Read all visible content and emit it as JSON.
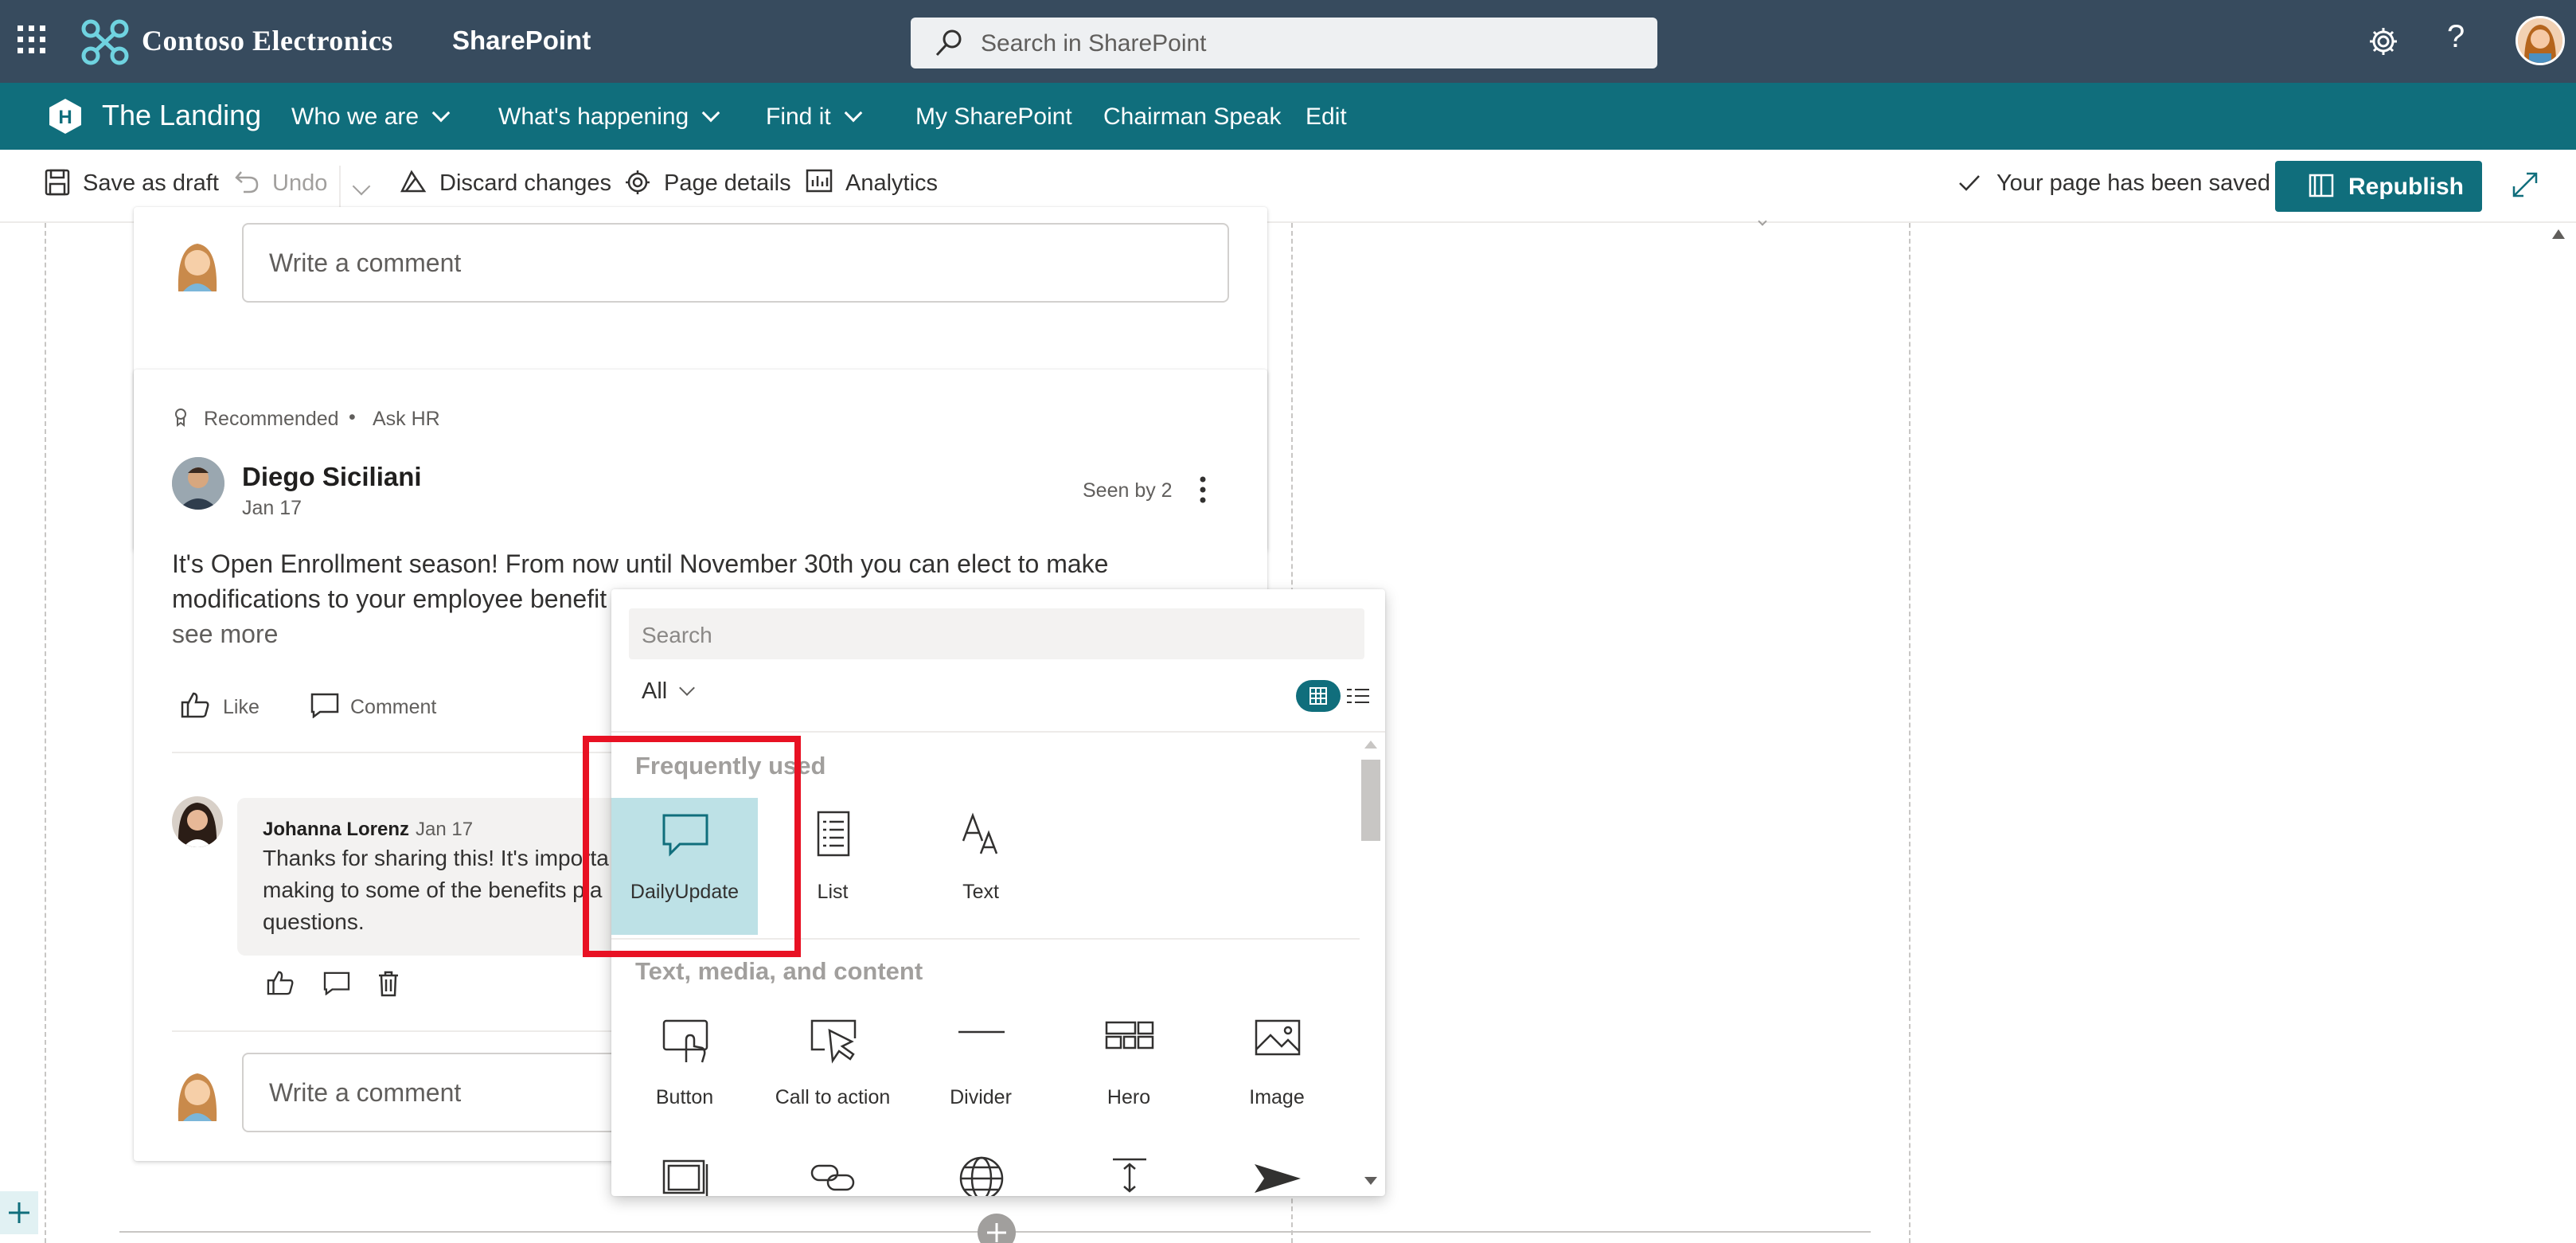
{
  "suite": {
    "org_name": "Contoso Electronics",
    "app_name": "SharePoint",
    "search_placeholder": "Search in SharePoint",
    "help_glyph": "?"
  },
  "hub": {
    "site_name": "The Landing",
    "nav": [
      {
        "label": "Who we are",
        "has_menu": true
      },
      {
        "label": "What's happening",
        "has_menu": true
      },
      {
        "label": "Find it",
        "has_menu": true
      },
      {
        "label": "My SharePoint",
        "has_menu": false
      },
      {
        "label": "Chairman Speak",
        "has_menu": false
      },
      {
        "label": "Edit",
        "has_menu": false
      }
    ]
  },
  "commandbar": {
    "save_draft": "Save as draft",
    "undo": "Undo",
    "discard": "Discard changes",
    "page_details": "Page details",
    "analytics": "Analytics",
    "saved_status": "Your page has been saved",
    "republish": "Republish"
  },
  "feed": {
    "comment_placeholder": "Write a comment",
    "post": {
      "tag_recommended": "Recommended",
      "bullet": "•",
      "tag_community": "Ask HR",
      "author": "Diego Siciliani",
      "date": "Jan 17",
      "seen": "Seen by 2",
      "text_line1": "It's Open Enrollment season! From now until November 30th you can elect to make",
      "text_line2": "modifications to your employee benefit",
      "see_more": "see more",
      "like": "Like",
      "comment": "Comment"
    },
    "reply": {
      "author": "Johanna Lorenz",
      "date": "Jan 17",
      "line1": "Thanks for sharing this! It's importa",
      "line2": "making to some of the benefits pla",
      "line3": "questions."
    }
  },
  "toolbox": {
    "search_placeholder": "Search",
    "filter": "All",
    "sections": {
      "frequent": "Frequently used",
      "text_media": "Text, media, and content"
    },
    "frequent_tools": [
      {
        "label": "DailyUpdate",
        "icon": "speech-bubble-icon",
        "selected": true
      },
      {
        "label": "List",
        "icon": "list-icon",
        "selected": false
      },
      {
        "label": "Text",
        "icon": "text-icon",
        "selected": false
      }
    ],
    "media_tools": [
      {
        "label": "Button",
        "icon": "button-icon"
      },
      {
        "label": "Call to action",
        "icon": "call-to-action-icon"
      },
      {
        "label": "Divider",
        "icon": "divider-icon"
      },
      {
        "label": "Hero",
        "icon": "hero-icon"
      },
      {
        "label": "Image",
        "icon": "image-icon"
      }
    ],
    "partial_row_icons": [
      "image-gallery-icon",
      "link-icon",
      "embed-globe-icon",
      "spacer-icon",
      "stream-icon"
    ]
  },
  "colors": {
    "suite_bar": "#374b5e",
    "hub_nav": "#106e7c",
    "accent": "#106e7c",
    "selected_tile": "#bde1e6",
    "highlight": "#e81123"
  }
}
